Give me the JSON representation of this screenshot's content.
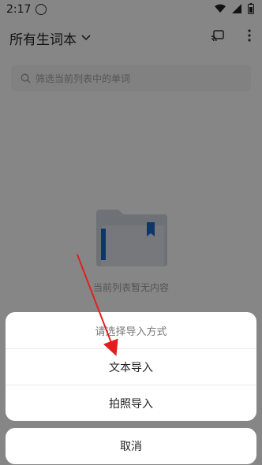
{
  "status": {
    "time": "2:17"
  },
  "header": {
    "title": "所有生词本"
  },
  "search": {
    "placeholder": "筛选当前列表中的单词"
  },
  "empty": {
    "text": "当前列表暂无内容"
  },
  "sheet": {
    "title": "请选择导入方式",
    "options": [
      {
        "label": "文本导入"
      },
      {
        "label": "拍照导入"
      }
    ],
    "cancel_label": "取消"
  },
  "colors": {
    "accent_blue": "#1b62c9",
    "annotation_red": "#e02020"
  }
}
